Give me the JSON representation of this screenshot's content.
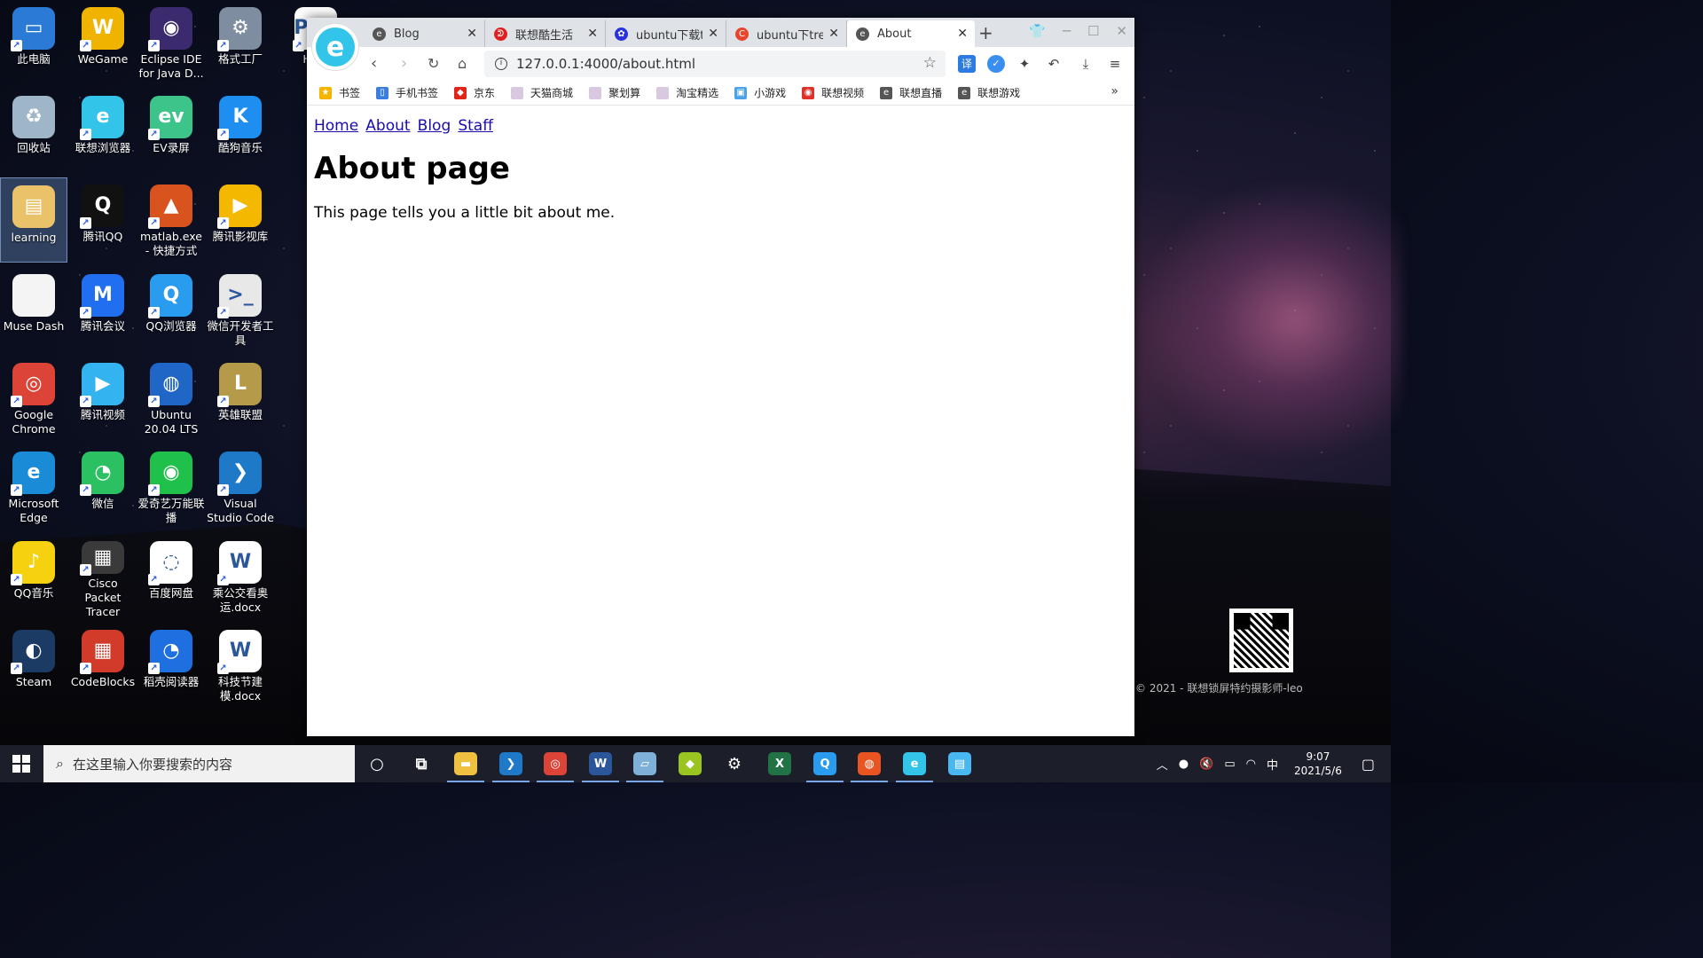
{
  "desktop": {
    "icons": [
      {
        "id": "this-pc",
        "label": "此电脑",
        "color": "#2b7bd6",
        "glyph": "▭"
      },
      {
        "id": "wegame",
        "label": "WeGame",
        "color": "#f0b400",
        "glyph": "W"
      },
      {
        "id": "eclipse",
        "label": "Eclipse IDE for Java D...",
        "color": "#3b2a6e",
        "glyph": "◉"
      },
      {
        "id": "format-factory",
        "label": "格式工厂",
        "color": "#7f8da0",
        "glyph": "⚙"
      },
      {
        "id": "home-pdf",
        "label": "Hom",
        "color": "#ffffff",
        "glyph": "PDF"
      },
      {
        "id": "recycle-bin",
        "label": "回收站",
        "color": "#9fb5c8",
        "glyph": "♻"
      },
      {
        "id": "lenovo-browser",
        "label": "联想浏览器",
        "color": "#33c4ea",
        "glyph": "e"
      },
      {
        "id": "ev-recorder",
        "label": "EV录屏",
        "color": "#3cc48a",
        "glyph": "ev"
      },
      {
        "id": "kugou",
        "label": "酷狗音乐",
        "color": "#1e8ef0",
        "glyph": "K"
      },
      {
        "id": "learning",
        "label": "learning",
        "color": "#e9c26a",
        "glyph": "▤"
      },
      {
        "id": "tencent-qq",
        "label": "腾讯QQ",
        "color": "#111111",
        "glyph": "Q"
      },
      {
        "id": "matlab",
        "label": "matlab.exe - 快捷方式",
        "color": "#d9531e",
        "glyph": "▲"
      },
      {
        "id": "tencent-video-lib",
        "label": "腾讯影视库",
        "color": "#f5b800",
        "glyph": "▶"
      },
      {
        "id": "muse-dash",
        "label": "Muse Dash",
        "color": "#f4f4f4",
        "glyph": ""
      },
      {
        "id": "tencent-meeting",
        "label": "腾讯会议",
        "color": "#1f6ff0",
        "glyph": "M"
      },
      {
        "id": "qq-browser",
        "label": "QQ浏览器",
        "color": "#2a9cf0",
        "glyph": "Q"
      },
      {
        "id": "wechat-devtools",
        "label": "微信开发者工具",
        "color": "#e8e8e8",
        "glyph": ">_"
      },
      {
        "id": "google-chrome",
        "label": "Google Chrome",
        "color": "#db4437",
        "glyph": "◎"
      },
      {
        "id": "tencent-video",
        "label": "腾讯视频",
        "color": "#33b4f0",
        "glyph": "▶"
      },
      {
        "id": "ubuntu",
        "label": "Ubuntu 20.04 LTS",
        "color": "#2066c6",
        "glyph": "◍"
      },
      {
        "id": "lol",
        "label": "英雄联盟",
        "color": "#b59a4a",
        "glyph": "L"
      },
      {
        "id": "edge",
        "label": "Microsoft Edge",
        "color": "#1a8bd6",
        "glyph": "e"
      },
      {
        "id": "wechat",
        "label": "微信",
        "color": "#2bc163",
        "glyph": "◔"
      },
      {
        "id": "iqiyi-cast",
        "label": "爱奇艺万能联播",
        "color": "#1fc14a",
        "glyph": "◉"
      },
      {
        "id": "vscode",
        "label": "Visual Studio Code",
        "color": "#1e7ac8",
        "glyph": "❯"
      },
      {
        "id": "qq-music",
        "label": "QQ音乐",
        "color": "#f5d10f",
        "glyph": "♪"
      },
      {
        "id": "cisco-pt",
        "label": "Cisco Packet Tracer",
        "color": "#3a3a3a",
        "glyph": "▦"
      },
      {
        "id": "baidu-netdisk",
        "label": "百度网盘",
        "color": "#ffffff",
        "glyph": "◌"
      },
      {
        "id": "docx-1",
        "label": "乘公交看奥运.docx",
        "color": "#ffffff",
        "glyph": "W"
      },
      {
        "id": "steam",
        "label": "Steam",
        "color": "#1b3a64",
        "glyph": "◐"
      },
      {
        "id": "codeblocks",
        "label": "CodeBlocks",
        "color": "#d23b2a",
        "glyph": "▦"
      },
      {
        "id": "daoke-reader",
        "label": "稻壳阅读器",
        "color": "#1e70e0",
        "glyph": "◔"
      },
      {
        "id": "docx-2",
        "label": "科技节建模.docx",
        "color": "#ffffff",
        "glyph": "W"
      }
    ],
    "watermark": "2021 - 联想锁屏特约摄影师-leo"
  },
  "browser": {
    "tabs": [
      {
        "title": "Blog",
        "favicon_color": "#555555",
        "favicon": "e"
      },
      {
        "title": "联想酷生活",
        "favicon_color": "#e02020",
        "favicon": "ᕲ"
      },
      {
        "title": "ubuntu下载t",
        "favicon_color": "#2932e1",
        "favicon": "✿"
      },
      {
        "title": "ubuntu下tre",
        "favicon_color": "#e8452c",
        "favicon": "C"
      },
      {
        "title": "About",
        "favicon_color": "#555555",
        "favicon": "e"
      }
    ],
    "new_tab": "+",
    "url": "127.0.0.1:4000/about.html",
    "bookmarks": [
      {
        "label": "书签",
        "color": "#f5b400",
        "glyph": "★"
      },
      {
        "label": "手机书签",
        "color": "#3b7de0",
        "glyph": "▯"
      },
      {
        "label": "京东",
        "color": "#e1251b",
        "glyph": "◆"
      },
      {
        "label": "天猫商城",
        "color": "#d8c8e0",
        "glyph": ""
      },
      {
        "label": "聚划算",
        "color": "#d8c8e0",
        "glyph": ""
      },
      {
        "label": "淘宝精选",
        "color": "#d8c8e0",
        "glyph": ""
      },
      {
        "label": "小游戏",
        "color": "#4aa3e8",
        "glyph": "▣"
      },
      {
        "label": "联想视频",
        "color": "#e0302a",
        "glyph": "◉"
      },
      {
        "label": "联想直播",
        "color": "#555555",
        "glyph": "e"
      },
      {
        "label": "联想游戏",
        "color": "#555555",
        "glyph": "e"
      }
    ],
    "bookmarks_more": "»"
  },
  "page": {
    "nav": [
      "Home",
      "About",
      "Blog",
      "Staff"
    ],
    "heading": "About page",
    "body": "This page tells you a little bit about me."
  },
  "taskbar": {
    "search_placeholder": "在这里输入你要搜索的内容",
    "apps": [
      {
        "name": "cortana",
        "color": "transparent",
        "glyph": "○"
      },
      {
        "name": "task-view",
        "color": "transparent",
        "glyph": "⧉"
      },
      {
        "name": "file-explorer",
        "color": "#f0c040",
        "glyph": "▬"
      },
      {
        "name": "vscode",
        "color": "#1e7ac8",
        "glyph": "❯"
      },
      {
        "name": "chrome",
        "color": "#db4437",
        "glyph": "◎"
      },
      {
        "name": "word",
        "color": "#2b579a",
        "glyph": "W"
      },
      {
        "name": "notes",
        "color": "#7fb0d8",
        "glyph": "▱"
      },
      {
        "name": "kugou-tray",
        "color": "#9ac520",
        "glyph": "◆"
      },
      {
        "name": "settings",
        "color": "transparent",
        "glyph": "⚙"
      },
      {
        "name": "excel",
        "color": "#217346",
        "glyph": "X"
      },
      {
        "name": "qq-browser",
        "color": "#2a9cf0",
        "glyph": "Q"
      },
      {
        "name": "ubuntu",
        "color": "#e95420",
        "glyph": "◍"
      },
      {
        "name": "lenovo-browser",
        "color": "#33c4ea",
        "glyph": "e"
      },
      {
        "name": "unknown-app",
        "color": "#4ab8f0",
        "glyph": "▤"
      }
    ],
    "ime": "中",
    "time": "9:07",
    "date": "2021/5/6"
  }
}
